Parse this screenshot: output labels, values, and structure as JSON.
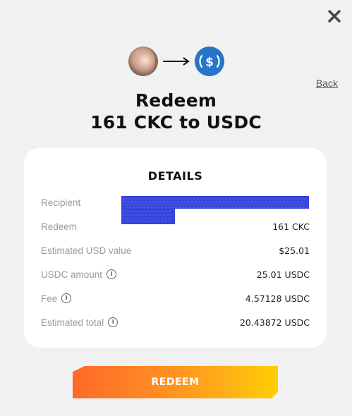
{
  "header": {
    "back_label": "Back"
  },
  "title": {
    "line1": "Redeem",
    "line2": "161 CKC to USDC"
  },
  "details": {
    "heading": "DETAILS",
    "rows": [
      {
        "label": "Recipient",
        "value": ""
      },
      {
        "label": "Redeem",
        "value": "161 CKC"
      },
      {
        "label": "Estimated USD value",
        "value": "$25.01"
      },
      {
        "label": "USDC amount",
        "value": "25.01 USDC",
        "info": true
      },
      {
        "label": "Fee",
        "value": "4.57128 USDC",
        "info": true
      },
      {
        "label": "Estimated total",
        "value": "20.43872 USDC",
        "info": true
      }
    ]
  },
  "action": {
    "redeem_label": "REDEEM"
  },
  "icons": {
    "close": "close-icon",
    "avatar": "avatar",
    "arrow": "arrow-right-icon",
    "coin": "usdc-icon",
    "info": "info-icon"
  },
  "colors": {
    "background": "#f1f1f1",
    "usdc_blue": "#2775ca",
    "scribble_blue": "#2b3bd8",
    "button_gradient_start": "#ff6a2a",
    "button_gradient_end": "#ffd000"
  }
}
